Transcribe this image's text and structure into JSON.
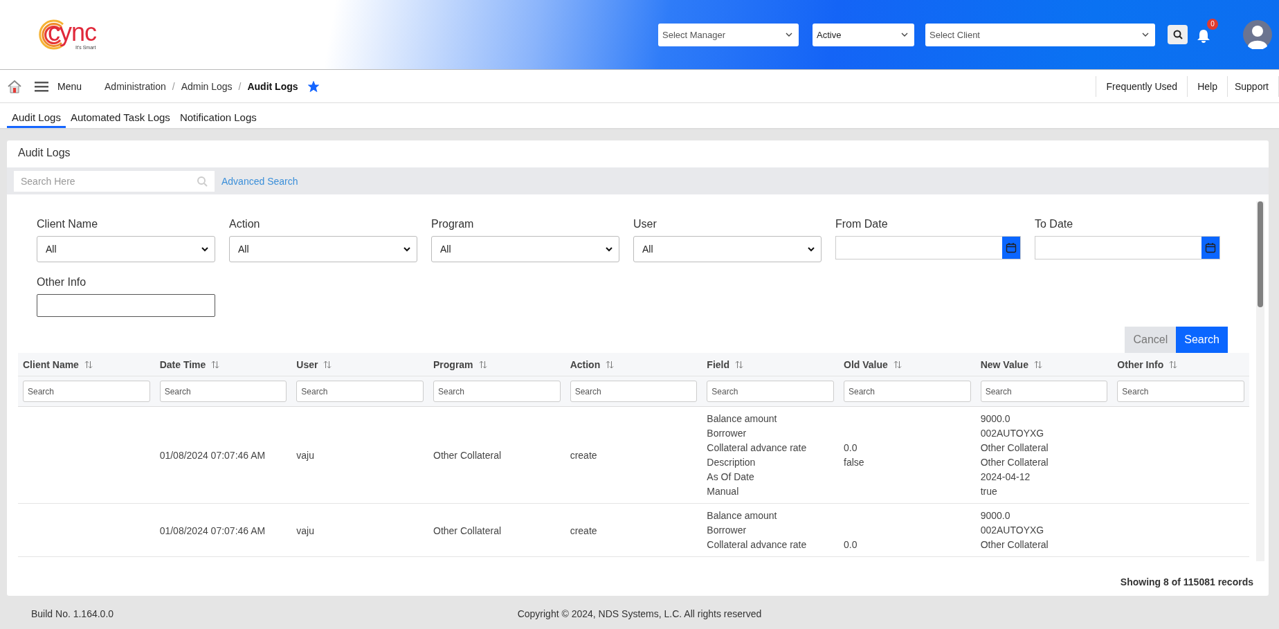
{
  "header": {
    "logo": {
      "name": "cync",
      "tagline": "It's Smart"
    },
    "dropdowns": [
      {
        "placeholder": "Select Manager"
      },
      {
        "value": "Active"
      },
      {
        "placeholder": "Select Client"
      }
    ],
    "notifications": {
      "count": "0"
    }
  },
  "nav": {
    "menu_label": "Menu",
    "breadcrumb": [
      {
        "label": "Administration",
        "current": false
      },
      {
        "label": "Admin Logs",
        "current": false
      },
      {
        "label": "Audit Logs",
        "current": true
      }
    ],
    "breadcrumb_separator": "/",
    "favorite": true,
    "links": [
      "Frequently Used",
      "Help",
      "Support"
    ]
  },
  "tabs": [
    {
      "label": "Audit Logs",
      "selected": true
    },
    {
      "label": "Automated Task Logs",
      "selected": false
    },
    {
      "label": "Notification Logs",
      "selected": false
    }
  ],
  "panel": {
    "title": "Audit Logs",
    "search": {
      "placeholder": "Search Here"
    },
    "advanced_search": "Advanced Search",
    "filters": [
      {
        "label": "Client Name",
        "kind": "select",
        "value": "All"
      },
      {
        "label": "Action",
        "kind": "select",
        "value": "All"
      },
      {
        "label": "Program",
        "kind": "select",
        "value": "All"
      },
      {
        "label": "User",
        "kind": "select",
        "value": "All"
      },
      {
        "label": "From Date",
        "kind": "date"
      },
      {
        "label": "To Date",
        "kind": "date"
      },
      {
        "label": "Other Info",
        "kind": "text"
      }
    ],
    "buttons": [
      {
        "label": "Cancel",
        "kind": "secondary"
      },
      {
        "label": "Search",
        "kind": "primary"
      }
    ],
    "table": {
      "columns": [
        {
          "label": "Client Name",
          "filter_placeholder": "Search"
        },
        {
          "label": "Date Time",
          "filter_placeholder": "Search"
        },
        {
          "label": "User",
          "filter_placeholder": "Search"
        },
        {
          "label": "Program",
          "filter_placeholder": "Search"
        },
        {
          "label": "Action",
          "filter_placeholder": "Search"
        },
        {
          "label": "Field",
          "filter_placeholder": "Search"
        },
        {
          "label": "Old Value",
          "filter_placeholder": "Search"
        },
        {
          "label": "New Value",
          "filter_placeholder": "Search"
        },
        {
          "label": "Other Info",
          "filter_placeholder": "Search"
        }
      ],
      "rows": [
        {
          "date_time": "01/08/2024 07:07:46 AM",
          "user": "vaju",
          "program": "Other Collateral",
          "action": "create",
          "changes": [
            {
              "field": "Balance amount",
              "new_value": "9000.0"
            },
            {
              "field": "Borrower",
              "new_value": "002AUTOYXG"
            },
            {
              "field": "Collateral advance rate",
              "old_value": "0.0",
              "new_value": "Other Collateral"
            },
            {
              "field": "Description",
              "old_value": "false",
              "new_value": "Other Collateral"
            },
            {
              "field": "As Of Date",
              "new_value": "2024-04-12"
            },
            {
              "field": "Manual",
              "new_value": "true"
            }
          ]
        },
        {
          "date_time": "01/08/2024 07:07:46 AM",
          "user": "vaju",
          "program": "Other Collateral",
          "action": "create",
          "changes": [
            {
              "field": "Balance amount",
              "new_value": "9000.0"
            },
            {
              "field": "Borrower",
              "new_value": "002AUTOYXG"
            },
            {
              "field": "Collateral advance rate",
              "old_value": "0.0",
              "new_value": "Other Collateral"
            }
          ]
        }
      ]
    },
    "records": "Showing 8 of 115081 records"
  },
  "footer": {
    "build": "Build No. 1.164.0.0",
    "copyright": "Copyright © 2024, NDS Systems, L.C. All rights reserved"
  }
}
